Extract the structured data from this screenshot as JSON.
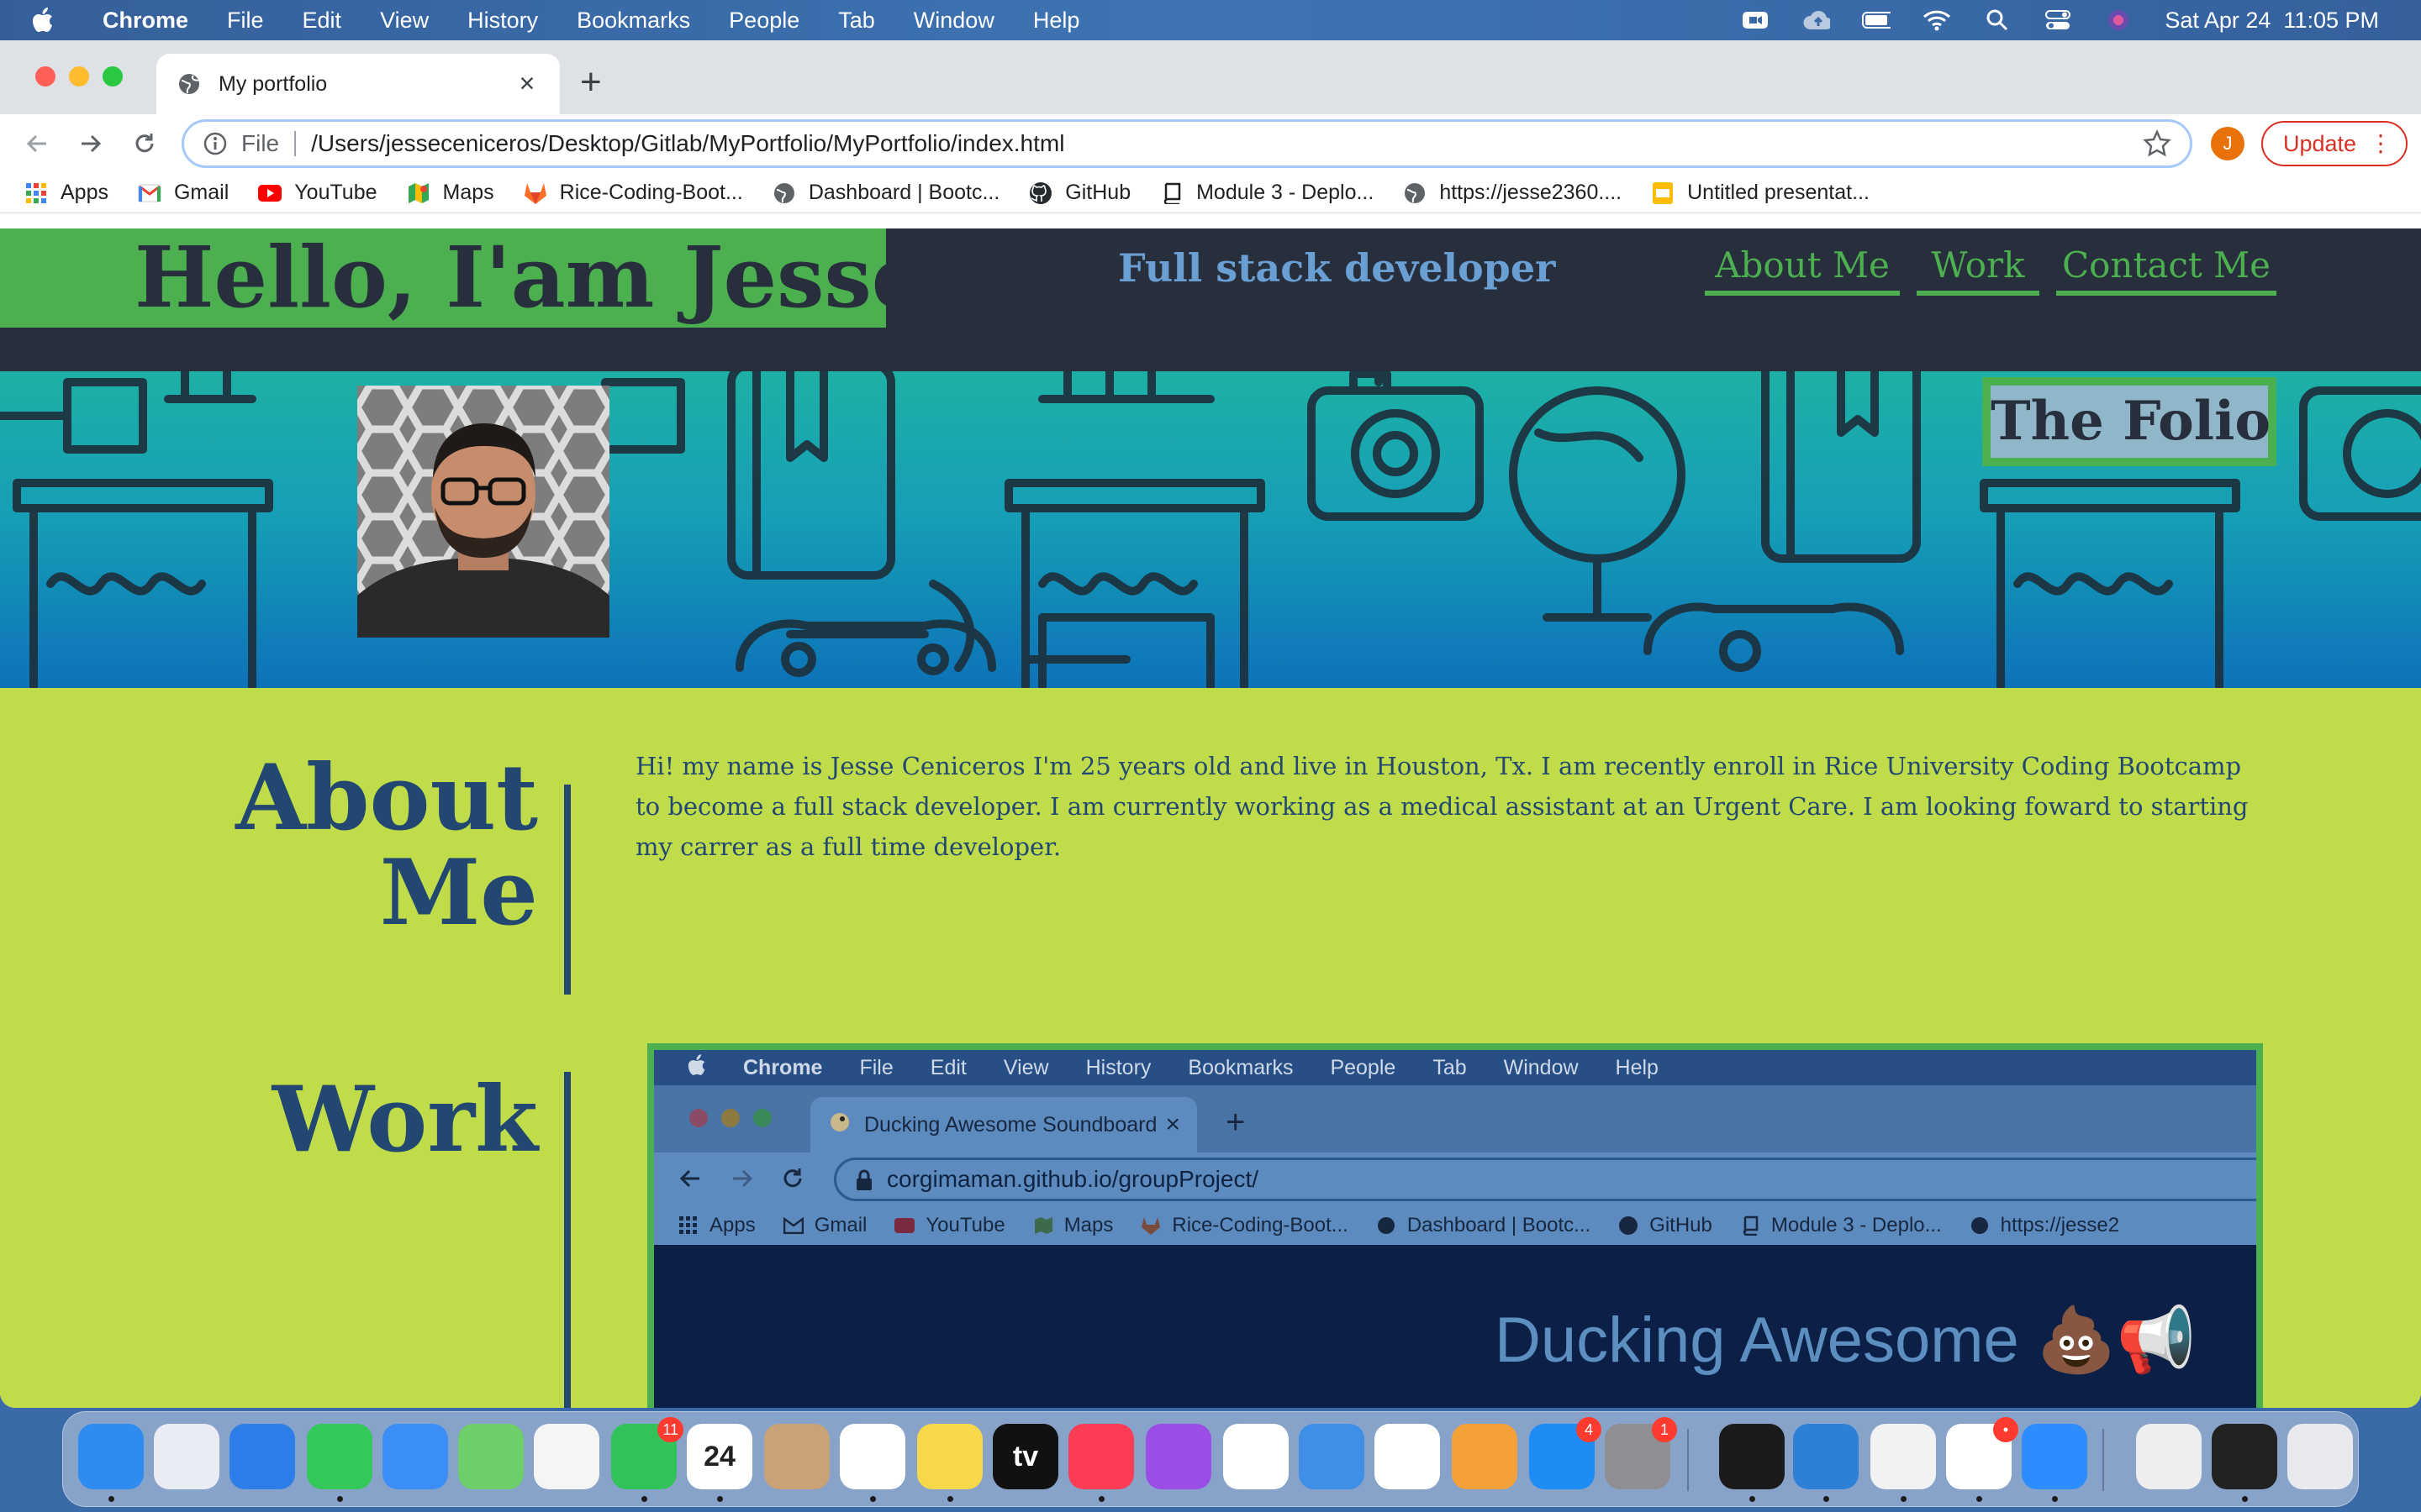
{
  "menubar": {
    "app": "Chrome",
    "items": [
      "File",
      "Edit",
      "View",
      "History",
      "Bookmarks",
      "People",
      "Tab",
      "Window",
      "Help"
    ],
    "datetime": "Sat Apr 24  11:05 PM"
  },
  "browser": {
    "tab_title": "My portfolio",
    "url_scheme": "File",
    "url": "/Users/jesseceniceros/Desktop/Gitlab/MyPortfolio/MyPortfolio/index.html",
    "profile_initial": "J",
    "update_label": "Update",
    "bookmarks": [
      {
        "label": "Apps",
        "icon": "apps-grid-icon"
      },
      {
        "label": "Gmail",
        "icon": "gmail-icon"
      },
      {
        "label": "YouTube",
        "icon": "youtube-icon"
      },
      {
        "label": "Maps",
        "icon": "maps-icon"
      },
      {
        "label": "Rice-Coding-Boot...",
        "icon": "gitlab-icon"
      },
      {
        "label": "Dashboard | Bootc...",
        "icon": "globe-icon"
      },
      {
        "label": "GitHub",
        "icon": "github-icon"
      },
      {
        "label": "Module 3 - Deplo...",
        "icon": "book-icon"
      },
      {
        "label": "https://jesse2360....",
        "icon": "globe-icon"
      },
      {
        "label": "Untitled presentat...",
        "icon": "slides-icon"
      }
    ]
  },
  "site": {
    "header_title": "Hello, I'am Jesse",
    "subtitle": "Full stack developer",
    "nav": [
      "About Me",
      "Work",
      "Contact Me"
    ],
    "hero_label": "The Folio",
    "about_title_line1": "About",
    "about_title_line2": "Me",
    "about_text": "Hi! my name is Jesse Ceniceros I'm 25 years old and live in Houston, Tx. I am recently enroll in Rice University Coding Bootcamp to become a full stack developer. I am currently working as a medical assistant at an Urgent Care. I am looking foward to starting my carrer as a full time developer.",
    "work_title": "Work"
  },
  "work_screenshot": {
    "menubar_app": "Chrome",
    "menubar_items": [
      "File",
      "Edit",
      "View",
      "History",
      "Bookmarks",
      "People",
      "Tab",
      "Window",
      "Help"
    ],
    "tab_title": "Ducking Awesome Soundboard",
    "url": "corgimaman.github.io/groupProject/",
    "bookmarks": [
      "Apps",
      "Gmail",
      "YouTube",
      "Maps",
      "Rice-Coding-Boot...",
      "Dashboard | Bootc...",
      "GitHub",
      "Module 3 - Deplo...",
      "https://jesse2"
    ],
    "heading": "Ducking Awesome 💩📢"
  },
  "dock": {
    "apps": [
      {
        "name": "finder",
        "color": "#2e8bf0"
      },
      {
        "name": "launchpad",
        "color": "#e9edf3"
      },
      {
        "name": "safari",
        "color": "#2d7ee8"
      },
      {
        "name": "messages",
        "color": "#34c759"
      },
      {
        "name": "mail",
        "color": "#3a8ef6"
      },
      {
        "name": "maps",
        "color": "#6ccf6a"
      },
      {
        "name": "photos",
        "color": "#f5f5f5"
      },
      {
        "name": "facetime",
        "color": "#32c25a",
        "badge": "11"
      },
      {
        "name": "calendar",
        "color": "#ffffff",
        "text": "24"
      },
      {
        "name": "contacts",
        "color": "#c9a277"
      },
      {
        "name": "reminders",
        "color": "#ffffff"
      },
      {
        "name": "notes",
        "color": "#f7d84a"
      },
      {
        "name": "tv",
        "color": "#111111",
        "text": "tv"
      },
      {
        "name": "music",
        "color": "#fa3c55"
      },
      {
        "name": "podcasts",
        "color": "#9b4ee6"
      },
      {
        "name": "news",
        "color": "#ffffff"
      },
      {
        "name": "keynote",
        "color": "#3f8ee8"
      },
      {
        "name": "numbers",
        "color": "#ffffff"
      },
      {
        "name": "pages",
        "color": "#f4a13a"
      },
      {
        "name": "app-store",
        "color": "#1e8cf4",
        "badge": "4"
      },
      {
        "name": "system-preferences",
        "color": "#8e8e93",
        "badge": "1"
      },
      {
        "name": "terminal",
        "color": "#1b1b1b"
      },
      {
        "name": "vscode",
        "color": "#2d80d6"
      },
      {
        "name": "chrome",
        "color": "#f2f2f2"
      },
      {
        "name": "slack",
        "color": "#ffffff",
        "badge": "•"
      },
      {
        "name": "zoom",
        "color": "#2d8cff"
      },
      {
        "name": "archive",
        "color": "#eeeeee"
      },
      {
        "name": "screen",
        "color": "#222222"
      },
      {
        "name": "trash",
        "color": "#e8eaee"
      }
    ]
  }
}
